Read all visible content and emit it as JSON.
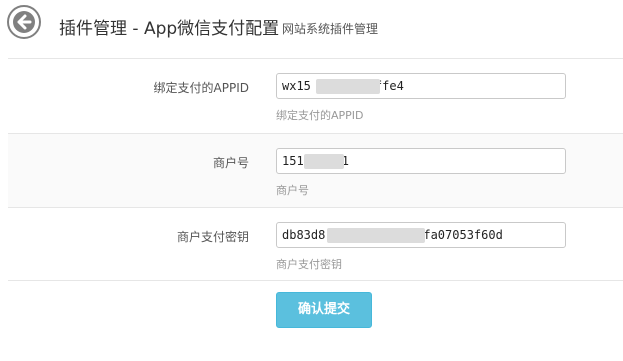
{
  "header": {
    "title": "插件管理 - App微信支付配置",
    "subtitle": "网站系统插件管理",
    "back_icon": "arrow-left-circle-icon"
  },
  "fields": [
    {
      "label": "绑定支付的APPID",
      "value_prefix": "wx15",
      "value_suffix": "ffe4",
      "help": "绑定支付的APPID"
    },
    {
      "label": "商户号",
      "value_prefix": "151",
      "value_suffix": "1",
      "help": "商户号"
    },
    {
      "label": "商户支付密钥",
      "value_prefix": "db83d8",
      "value_suffix": "fa07053f60d",
      "help": "商户支付密钥"
    }
  ],
  "submit_label": "确认提交",
  "colors": {
    "accent": "#5bc0de",
    "border": "#c9c9c9",
    "muted_text": "#999999"
  }
}
